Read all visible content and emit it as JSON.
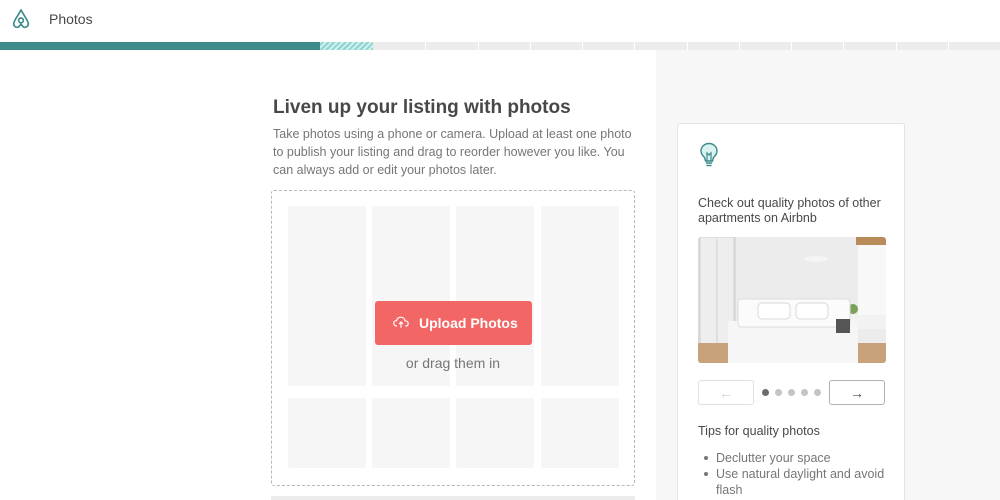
{
  "header": {
    "logo_icon": "airbnb-logo-icon",
    "page_label": "Photos",
    "brand_color": "#ff5a5f"
  },
  "progress": {
    "completed_fraction": 0.32,
    "in_progress_fraction": 0.053,
    "steps": 18,
    "fill_color": "#3d8a8a"
  },
  "main": {
    "heading": "Liven up your listing with photos",
    "description": "Take photos using a phone or camera. Upload at least one photo to publish your listing and drag to reorder however you like. You can always add or edit your photos later.",
    "upload_label": "Upload Photos",
    "upload_icon": "cloud-upload-icon",
    "upload_color": "#f26666",
    "drag_text": "or drag them in"
  },
  "sidebar": {
    "card": {
      "icon": "lightbulb-icon",
      "title": "Check out quality photos of other apartments on Airbnb",
      "prev_label": "←",
      "next_label": "→",
      "dots": 5,
      "active_dot": 0,
      "tips_title": "Tips for quality photos",
      "tips": [
        "Declutter your space",
        "Use natural daylight and avoid flash"
      ]
    }
  }
}
